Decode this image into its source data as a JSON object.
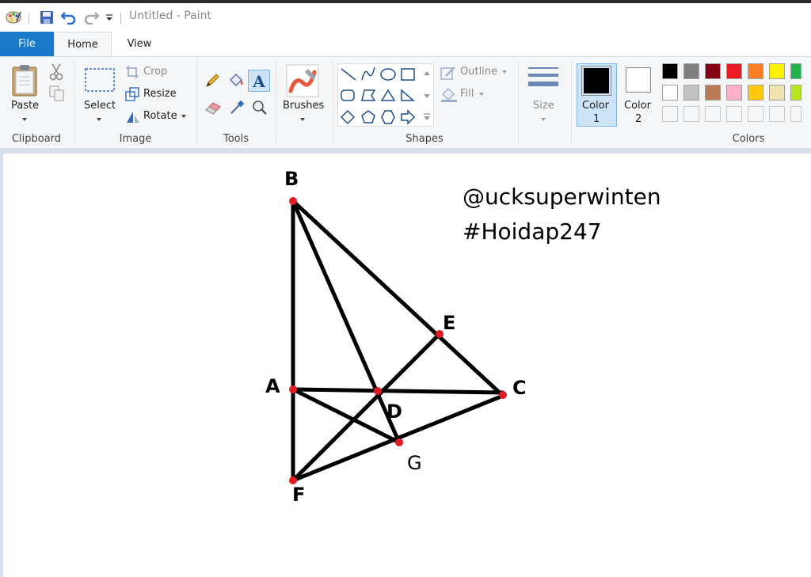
{
  "window": {
    "title": "Untitled - Paint"
  },
  "tabs": {
    "file": "File",
    "home": "Home",
    "view": "View"
  },
  "clipboard": {
    "paste": "Paste",
    "group": "Clipboard"
  },
  "image": {
    "select": "Select",
    "crop": "Crop",
    "resize": "Resize",
    "rotate": "Rotate",
    "group": "Image"
  },
  "tools": {
    "group": "Tools"
  },
  "brushes": {
    "label": "Brushes"
  },
  "shapes": {
    "outline": "Outline",
    "fill": "Fill",
    "group": "Shapes"
  },
  "size": {
    "label": "Size"
  },
  "colors": {
    "color1_label": "Color",
    "color1_num": "1",
    "color2_label": "Color",
    "color2_num": "2",
    "group": "Colors",
    "color1_value": "#000000",
    "color2_value": "#ffffff",
    "palette_row1": [
      "#000000",
      "#7f7f7f",
      "#880015",
      "#ed1c24",
      "#ff7f27",
      "#fff200",
      "#22b14c"
    ],
    "palette_row2": [
      "#ffffff",
      "#c3c3c3",
      "#b97a57",
      "#ffaec9",
      "#ffc90e",
      "#efe4b0",
      "#b5e61d"
    ]
  },
  "canvas": {
    "handle": "@ucksuperwinten",
    "hashtag": "#Hoidap247",
    "points": {
      "B": "B",
      "E": "E",
      "A": "A",
      "D": "D",
      "C": "C",
      "G": "G",
      "F": "F"
    },
    "line_color": "#000000",
    "point_color": "#e31b23"
  }
}
